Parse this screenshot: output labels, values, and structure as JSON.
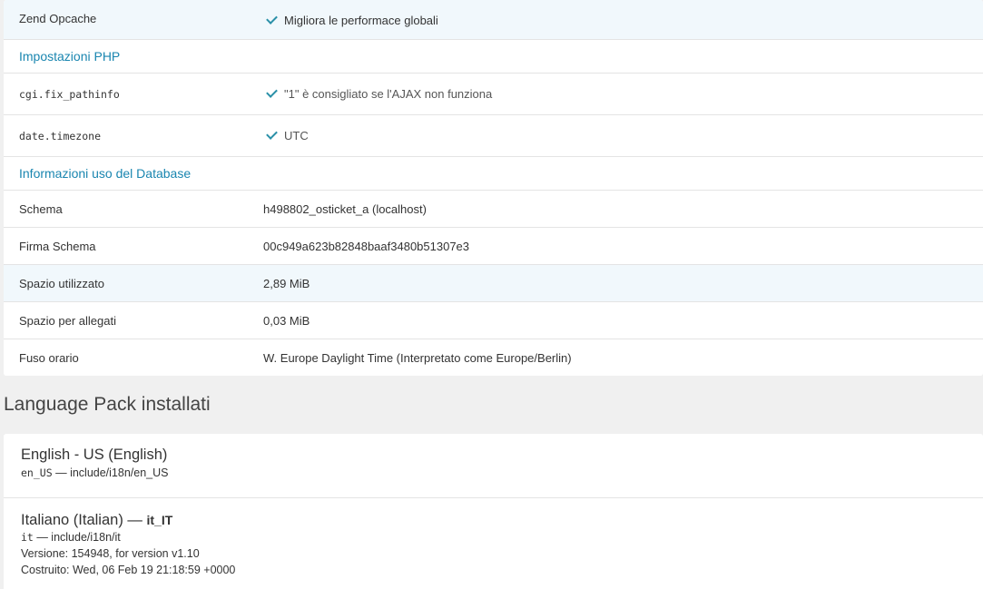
{
  "top_panel": {
    "opcache": {
      "label": "Zend Opcache",
      "value": "Migliora le performace globali"
    }
  },
  "php_settings": {
    "heading": "Impostazioni PHP",
    "rows": [
      {
        "label": "cgi.fix_pathinfo",
        "value": "\"1\" è consigliato se l'AJAX non funziona"
      },
      {
        "label": "date.timezone",
        "value": "UTC"
      }
    ]
  },
  "database_info": {
    "heading": "Informazioni uso del Database",
    "rows": [
      {
        "label": "Schema",
        "value": "h498802_osticket_a (localhost)"
      },
      {
        "label": "Firma Schema",
        "value": "00c949a623b82848baaf3480b51307e3"
      },
      {
        "label": "Spazio utilizzato",
        "value": "2,89 MiB"
      },
      {
        "label": "Spazio per allegati",
        "value": "0,03 MiB"
      },
      {
        "label": "Fuso orario",
        "value": "W. Europe Daylight Time (Interpretato come Europe/Berlin)"
      }
    ]
  },
  "language_packs": {
    "title": "Language Pack installati",
    "packs": [
      {
        "name": "English - US (English)",
        "code_prefix": "en_US",
        "path_line": " — include/i18n/en_US"
      },
      {
        "name": "Italiano (Italian) — ",
        "code": "it_IT",
        "code_prefix": "it",
        "path_line": " — include/i18n/it",
        "version": "Versione: 154948, for version v1.10",
        "built": "Costruito: Wed, 06 Feb 19 21:18:59 +0000"
      }
    ]
  }
}
